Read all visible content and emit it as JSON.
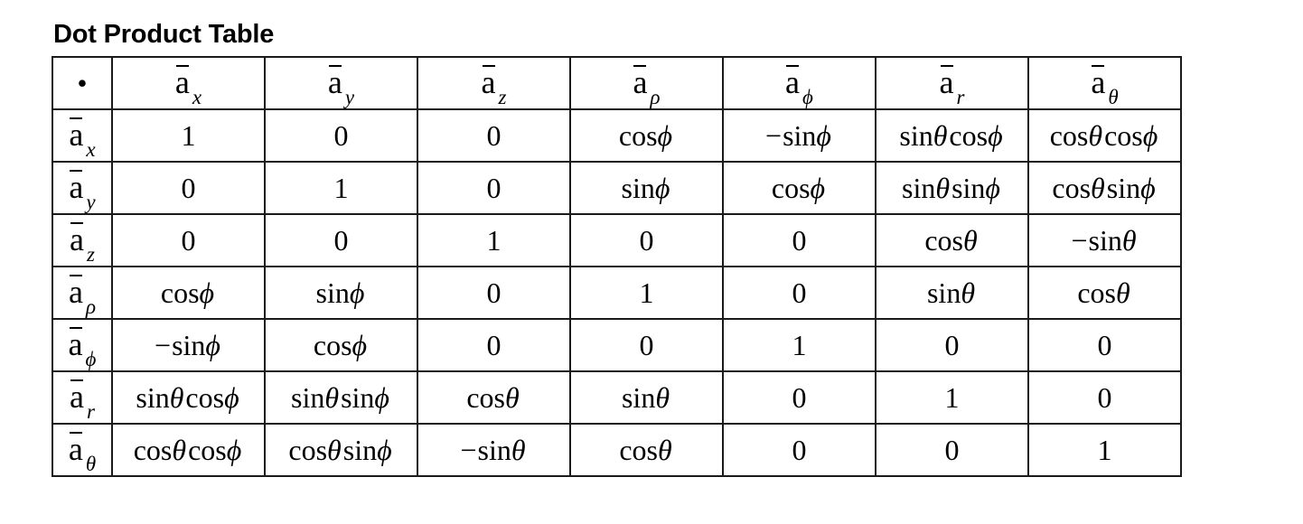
{
  "title": "Dot Product Table",
  "corner_symbol": "•",
  "columns": [
    {
      "base": "a",
      "sub": "x"
    },
    {
      "base": "a",
      "sub": "y"
    },
    {
      "base": "a",
      "sub": "z"
    },
    {
      "base": "a",
      "sub": "ρ"
    },
    {
      "base": "a",
      "sub": "ϕ"
    },
    {
      "base": "a",
      "sub": "r"
    },
    {
      "base": "a",
      "sub": "θ"
    }
  ],
  "rows": [
    {
      "header": {
        "base": "a",
        "sub": "x"
      },
      "cells": [
        "1",
        "0",
        "0",
        "cos ϕ",
        "−sin ϕ",
        "sin θ cos ϕ",
        "cos θ cos ϕ"
      ]
    },
    {
      "header": {
        "base": "a",
        "sub": "y"
      },
      "cells": [
        "0",
        "1",
        "0",
        "sin ϕ",
        "cos ϕ",
        "sin θ sin ϕ",
        "cos θ sin ϕ"
      ]
    },
    {
      "header": {
        "base": "a",
        "sub": "z"
      },
      "cells": [
        "0",
        "0",
        "1",
        "0",
        "0",
        "cos θ",
        "−sin θ"
      ]
    },
    {
      "header": {
        "base": "a",
        "sub": "ρ"
      },
      "cells": [
        "cos ϕ",
        "sin ϕ",
        "0",
        "1",
        "0",
        "sin θ",
        "cos θ"
      ]
    },
    {
      "header": {
        "base": "a",
        "sub": "ϕ"
      },
      "cells": [
        "−sin ϕ",
        "cos ϕ",
        "0",
        "0",
        "1",
        "0",
        "0"
      ]
    },
    {
      "header": {
        "base": "a",
        "sub": "r"
      },
      "cells": [
        "sin θ cos ϕ",
        "sin θ sin ϕ",
        "cos θ",
        "sin θ",
        "0",
        "1",
        "0"
      ]
    },
    {
      "header": {
        "base": "a",
        "sub": "θ"
      },
      "cells": [
        "cos θ cos ϕ",
        "cos θ sin ϕ",
        "−sin θ",
        "cos θ",
        "0",
        "0",
        "1"
      ]
    }
  ]
}
